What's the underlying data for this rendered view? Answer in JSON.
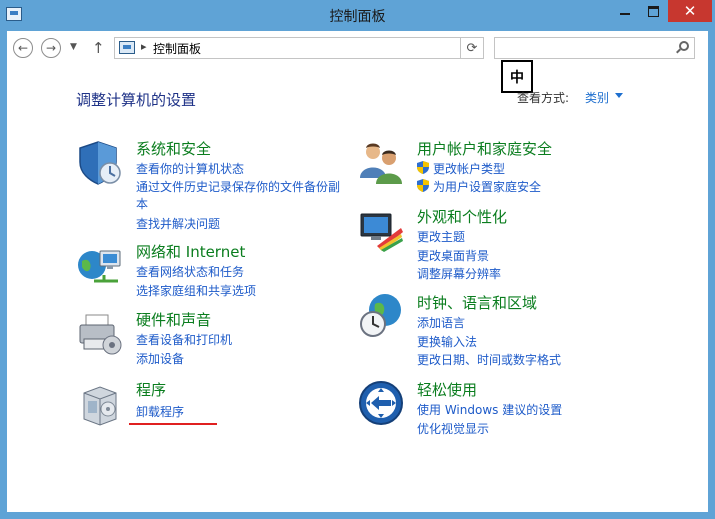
{
  "window": {
    "title": "控制面板",
    "close_glyph": "✕"
  },
  "nav": {
    "back_glyph": "←",
    "forward_glyph": "→",
    "recent_glyph": "▼",
    "up_glyph": "↑",
    "address_separator": "▸",
    "address_text": "控制面板",
    "refresh_glyph": "⟳",
    "search_placeholder": ""
  },
  "ime": {
    "label": "中"
  },
  "header": {
    "heading": "调整计算机的设置",
    "viewby_label": "查看方式:",
    "viewby_value": "类别"
  },
  "categories": [
    {
      "icon": "shield-security-icon",
      "title": "系统和安全",
      "links": [
        "查看你的计算机状态",
        "通过文件历史记录保存你的文件备份副",
        "本",
        "查找并解决问题"
      ]
    },
    {
      "icon": "network-globe-icon",
      "title": "网络和 Internet",
      "links": [
        "查看网络状态和任务",
        "选择家庭组和共享选项"
      ]
    },
    {
      "icon": "printer-icon",
      "title": "硬件和声音",
      "links": [
        "查看设备和打印机",
        "添加设备"
      ]
    },
    {
      "icon": "programs-box-icon",
      "title": "程序",
      "links": [
        "卸载程序"
      ]
    },
    {
      "icon": "user-accounts-icon",
      "title": "用户帐户和家庭安全",
      "links": [
        "更改帐户类型",
        "为用户设置家庭安全"
      ]
    },
    {
      "icon": "appearance-monitor-icon",
      "title": "外观和个性化",
      "links": [
        "更改主题",
        "更改桌面背景",
        "调整屏幕分辨率"
      ]
    },
    {
      "icon": "clock-globe-icon",
      "title": "时钟、语言和区域",
      "links": [
        "添加语言",
        "更换输入法",
        "更改日期、时间或数字格式"
      ]
    },
    {
      "icon": "ease-of-access-icon",
      "title": "轻松使用",
      "links": [
        "使用 Windows 建议的设置",
        "优化视觉显示"
      ]
    }
  ],
  "colors": {
    "title_bar": "#5fa3d6",
    "close_button": "#c7372f",
    "category_title": "#0a7d1e",
    "link": "#1e5bc9",
    "heading": "#1e3287",
    "annotation_underline": "#e02020"
  }
}
